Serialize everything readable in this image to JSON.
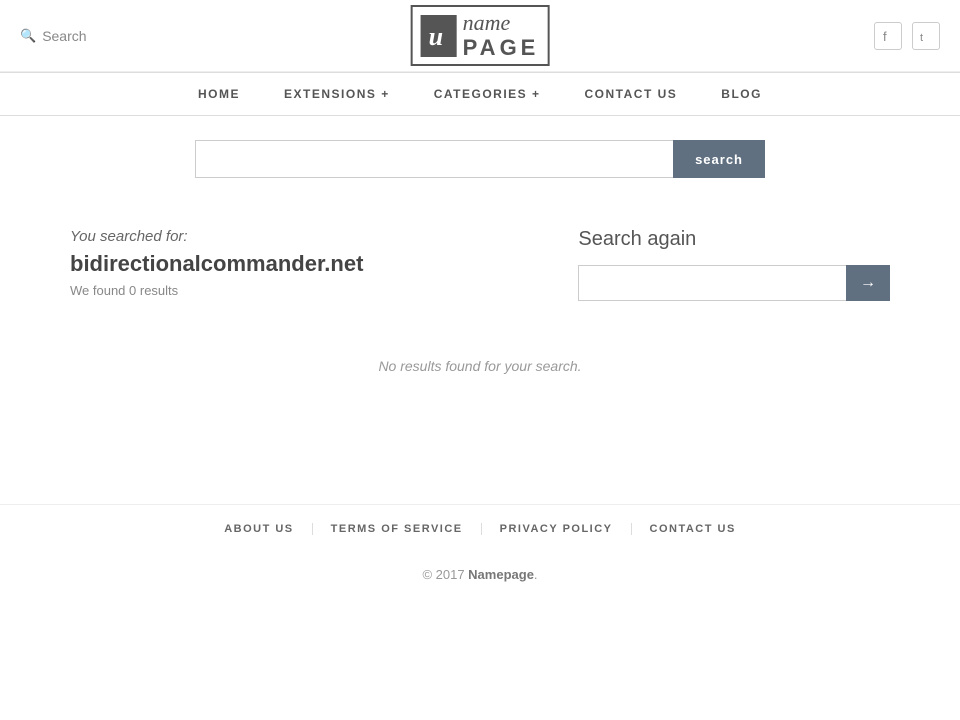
{
  "header": {
    "search_label": "Search",
    "logo_icon": "u",
    "logo_name": "name",
    "logo_page": "PAGE",
    "facebook_icon": "f",
    "twitter_icon": "t"
  },
  "nav": {
    "items": [
      {
        "label": "HOME",
        "has_dropdown": false
      },
      {
        "label": "EXTENSIONS +",
        "has_dropdown": true
      },
      {
        "label": "CATEGORIES +",
        "has_dropdown": true
      },
      {
        "label": "CONTACT US",
        "has_dropdown": false
      },
      {
        "label": "BLOG",
        "has_dropdown": false
      }
    ]
  },
  "search_bar": {
    "placeholder": "",
    "button_label": "search"
  },
  "results": {
    "you_searched_label": "You searched for:",
    "search_term": "bidirectionalcommander.net",
    "results_count": "We found 0 results",
    "no_results_message": "No results found for your search."
  },
  "search_again": {
    "title": "Search again",
    "button_label": "→"
  },
  "footer_nav": {
    "items": [
      {
        "label": "ABOUT US"
      },
      {
        "label": "TERMS OF SERVICE"
      },
      {
        "label": "PRIVACY POLICY"
      },
      {
        "label": "CONTACT US"
      }
    ]
  },
  "copyright": {
    "text": "© 2017 ",
    "brand": "Namepage",
    "suffix": "."
  }
}
